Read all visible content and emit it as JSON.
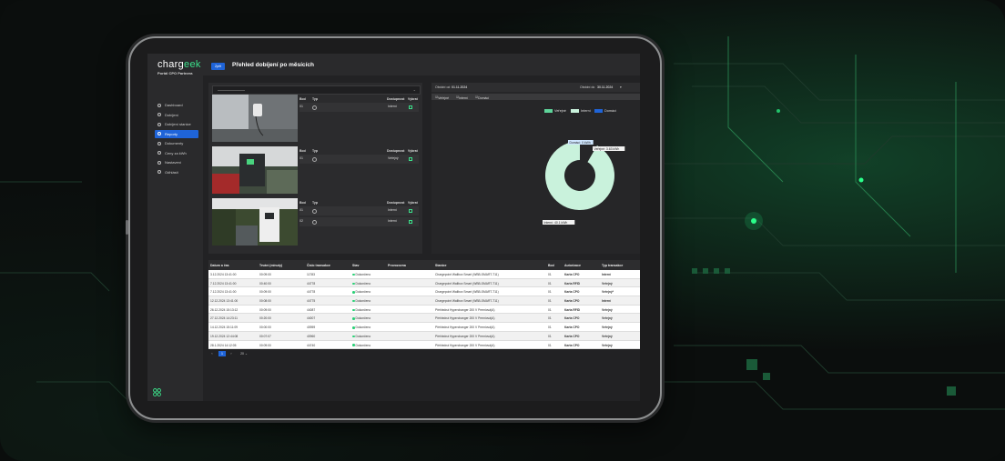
{
  "app": {
    "logo_text": "charg",
    "logo_accent": "eek",
    "subtitle": "Portál CPO Partnera"
  },
  "header": {
    "back_label": "Zpět",
    "title": "Přehled dobíjení po měsících"
  },
  "sidebar": {
    "items": [
      {
        "label": "Dashboard",
        "icon": "home-icon"
      },
      {
        "label": "Dobíjení",
        "icon": "bolt-icon"
      },
      {
        "label": "Dobíjení stanice",
        "icon": "station-icon"
      },
      {
        "label": "Reporty",
        "icon": "report-icon",
        "active": true
      },
      {
        "label": "Dokumenty",
        "icon": "document-icon"
      },
      {
        "label": "Ceny za kWh",
        "icon": "price-icon"
      },
      {
        "label": "Nastavení",
        "icon": "gear-icon"
      },
      {
        "label": "Odhlásit",
        "icon": "logout-icon"
      }
    ]
  },
  "stations": {
    "headers": {
      "bod": "Bod",
      "typ": "Typ",
      "dostupnost": "Dostupnost",
      "vybrat": "Vybrat"
    },
    "items": [
      {
        "rows": [
          {
            "bod": "01",
            "access": "Interní"
          }
        ]
      },
      {
        "rows": [
          {
            "bod": "01",
            "access": "Veřejný"
          }
        ]
      },
      {
        "rows": [
          {
            "bod": "01",
            "access": "Interní"
          },
          {
            "bod": "02",
            "access": "Interní"
          }
        ]
      }
    ]
  },
  "period": {
    "from_label": "Období od",
    "from_value": "01.11.2024",
    "to_label": "Období do",
    "to_value": "30.11.2024"
  },
  "filters": {
    "items": [
      "Veřejné",
      "Interní",
      "Domácí"
    ]
  },
  "chart_data": {
    "type": "pie",
    "legend": [
      "Veřejné",
      "Interní",
      "Domácí"
    ],
    "legend_colors": [
      "#5ed49a",
      "#c9f2dc",
      "#1f64d8"
    ],
    "values": [
      0,
      40.1,
      3.63
    ],
    "callouts": [
      "Domácí: 0 kWh",
      "Veřejné: 3.63 kWh",
      "Interní: 40.1 kWh"
    ]
  },
  "table": {
    "columns": [
      "Datum a čas",
      "Trvání (minuty)",
      "Číslo transakce",
      "Stav",
      "Provozovna",
      "Stanice",
      "Bod",
      "Autorizace",
      "Typ transakce"
    ],
    "rows": [
      [
        "3.12.2024 13:41:00",
        "00:09:00",
        "11783",
        "Dokončeno",
        "",
        "Chargepoint Wallbox Smart (WBB-SMART-T11)",
        "01",
        "Karta CPO",
        "Interní"
      ],
      [
        "7.12.2024 13:41:00",
        "00:40:00",
        "44778",
        "Dokončeno",
        "",
        "Chargepoint Wallbox Smart (WBB-SMART-T11)",
        "01",
        "Karta RFID",
        "Veřejný"
      ],
      [
        "7.12.2024 13:41:00",
        "00:09:00",
        "44778",
        "Dokončeno",
        "",
        "Chargepoint Wallbox Smart (WBB-SMART-T11)",
        "01",
        "Karta CPO",
        "Veřejný*"
      ],
      [
        "12.12.2024 13:41:00",
        "00:08:00",
        "44775",
        "Dokončeno",
        "",
        "Chargepoint Wallbox Smart (WBB-SMART-T11)",
        "01",
        "Karta CPO",
        "Interní"
      ],
      [
        "26.12.2024 15:13:12",
        "00:09:00",
        "44087",
        "Dokončeno",
        "",
        "Přehledná Hyperchanger 200 V Premiová(A)",
        "01",
        "Karta RFID",
        "Veřejný"
      ],
      [
        "27.12.2024 14:23:11",
        "00:20:00",
        "44007",
        "Dokončeno",
        "",
        "Přehledná Hyperchanger 200 V Premiová(A)",
        "01",
        "Karta CPO",
        "Veřejný"
      ],
      [
        "14.12.2024 15:11:09",
        "00:00:00",
        "40959",
        "Dokončeno",
        "",
        "Přehledná Hyperchanger 200 V Premiová(A)",
        "01",
        "Karta CPO",
        "Veřejný"
      ],
      [
        "19.12.2024 12:44:08",
        "00:07:07",
        "40960",
        "Dokončeno",
        "",
        "Přehledná Hyperchanger 200 V Premiová(A)",
        "01",
        "Karta CPO",
        "Veřejný"
      ],
      [
        "28.1.2024 14:12:05",
        "00:09:00",
        "44740",
        "Dokončeno",
        "",
        "Přehledná Hyperchanger 200 V Premiová(A)",
        "01",
        "Karta CPO",
        "Veřejný"
      ]
    ]
  },
  "pagination": {
    "page": "1",
    "page_size": "20"
  }
}
